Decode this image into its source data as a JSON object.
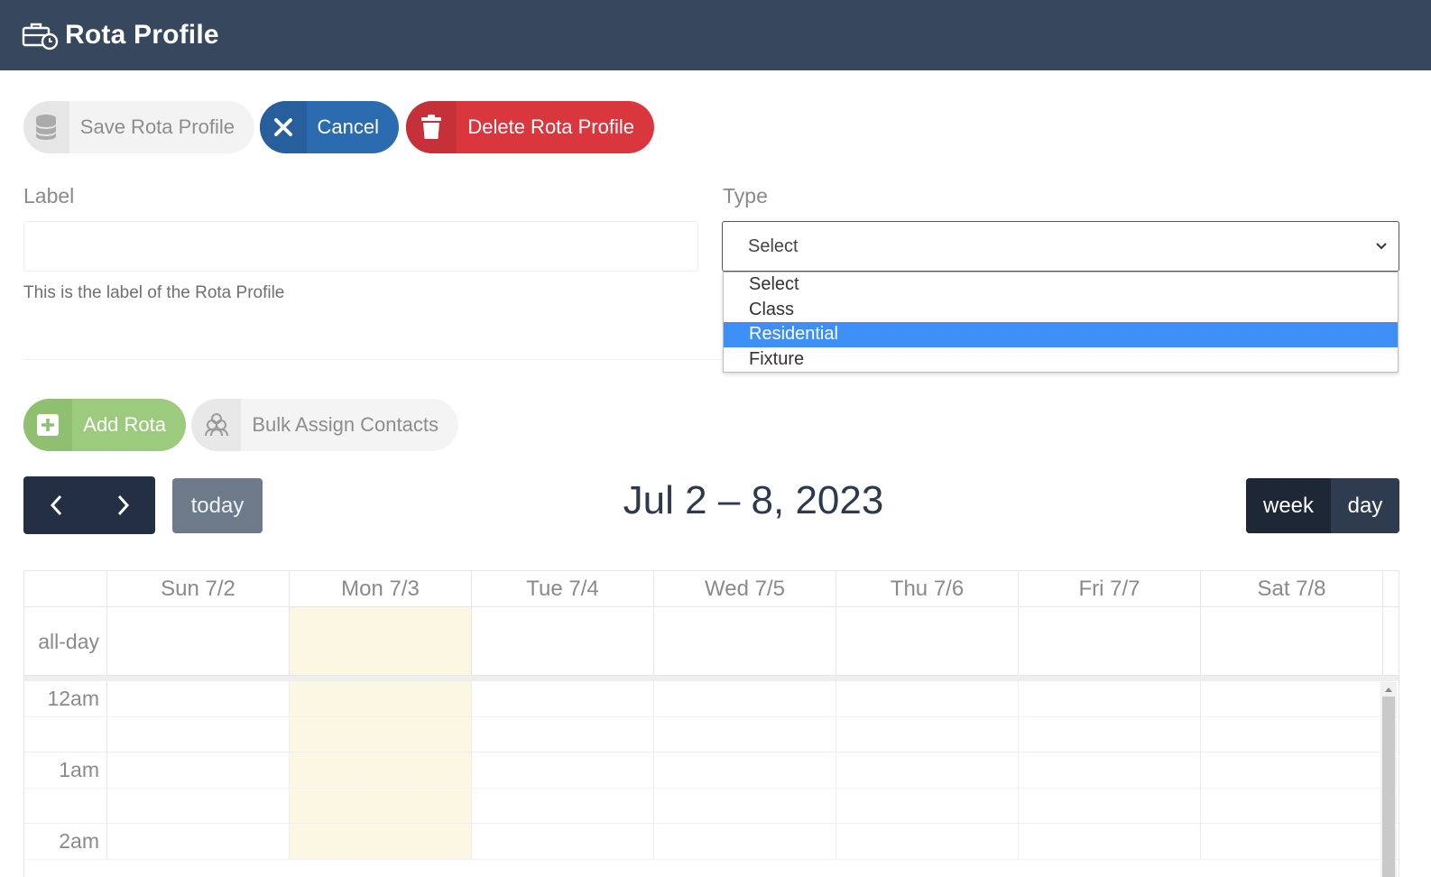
{
  "header": {
    "title": "Rota Profile",
    "icon": "briefcase-clock-icon"
  },
  "actions": {
    "save_label": "Save Rota Profile",
    "cancel_label": "Cancel",
    "delete_label": "Delete Rota Profile"
  },
  "form": {
    "label_field": {
      "label": "Label",
      "value": "",
      "help": "This is the label of the Rota Profile"
    },
    "type_field": {
      "label": "Type",
      "selected": "Select",
      "options": [
        "Select",
        "Class",
        "Residential",
        "Fixture"
      ],
      "highlighted": "Residential"
    }
  },
  "rota_actions": {
    "add_label": "Add Rota",
    "bulk_label": "Bulk Assign Contacts"
  },
  "calendar": {
    "title": "Jul 2 – 8, 2023",
    "today_label": "today",
    "views": {
      "week": "week",
      "day": "day"
    },
    "active_view": "week",
    "columns": [
      "Sun 7/2",
      "Mon 7/3",
      "Tue 7/4",
      "Wed 7/5",
      "Thu 7/6",
      "Fri 7/7",
      "Sat 7/8"
    ],
    "today_column": "Mon 7/3",
    "allday_label": "all-day",
    "times": [
      "12am",
      "1am",
      "2am"
    ]
  },
  "colors": {
    "header_bg": "#37475e",
    "cancel": "#2b6cb0",
    "delete": "#d9363e",
    "add_rota": "#9ccb7e",
    "highlight": "#3d8ff5",
    "today_bg": "#fbf7e3"
  }
}
